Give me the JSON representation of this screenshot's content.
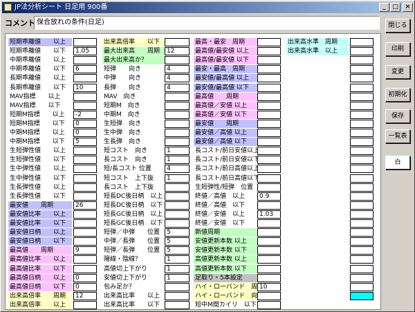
{
  "window": {
    "title": "JP法分析シート 日足用 900番",
    "minimize": "_",
    "maximize": "□",
    "close": "×"
  },
  "comment": {
    "label": "コメント",
    "value": "保合放れの条件(日足)"
  },
  "buttons": [
    {
      "name": "close-button",
      "label": "閉じる"
    },
    {
      "name": "print-button",
      "label": "印刷"
    },
    {
      "name": "change-button",
      "label": "変更"
    },
    {
      "name": "initialize-button",
      "label": "初期化"
    },
    {
      "name": "save-button",
      "label": "保存"
    },
    {
      "name": "list-button",
      "label": "一覧表"
    },
    {
      "name": "white-button",
      "label": "白"
    }
  ],
  "colors": {
    "yellow": "#ffffc0",
    "green": "#c0ffc0",
    "blue": "#c0c0ff",
    "pink": "#ffc0ff",
    "cyan": "#c0ffff",
    "gray": "#c0c0c0",
    "white": "#ffffff"
  },
  "columns": [
    {
      "rows": [
        {
          "label": "短期乖離値　　以上",
          "color": "blue",
          "value": ""
        },
        {
          "label": "短期乖離値　　以下",
          "color": "white",
          "value": "1.05"
        },
        {
          "label": "中期乖離値　　以上",
          "color": "white",
          "value": ""
        },
        {
          "label": "中期乖離値　　以下",
          "color": "white",
          "value": "6"
        },
        {
          "label": "長期乖離値　　以上",
          "color": "white",
          "value": ""
        },
        {
          "label": "長期乖離値　　以下",
          "color": "white",
          "value": "10"
        },
        {
          "label": "MAV指標　　以上",
          "color": "white",
          "value": ""
        },
        {
          "label": "MAV指標　　以下",
          "color": "white",
          "value": ""
        },
        {
          "label": "短期M指標　　以上",
          "color": "white",
          "value": "-2"
        },
        {
          "label": "短期M指標　　以下",
          "color": "white",
          "value": "0"
        },
        {
          "label": "中期M指標　　以上",
          "color": "white",
          "value": "0"
        },
        {
          "label": "中期M指標　　以下",
          "color": "white",
          "value": "5"
        },
        {
          "label": "生短弾性値　　以上",
          "color": "white",
          "value": ""
        },
        {
          "label": "生短弾性値　　以下",
          "color": "white",
          "value": ""
        },
        {
          "label": "生中弾性値　　以上",
          "color": "white",
          "value": ""
        },
        {
          "label": "生中弾性値　　以下",
          "color": "white",
          "value": ""
        },
        {
          "label": "生長弾性値　　以上",
          "color": "white",
          "value": ""
        },
        {
          "label": "生長弾性値　　以下",
          "color": "white",
          "value": ""
        },
        {
          "label": "最安値　　周期",
          "color": "blue",
          "value": "26"
        },
        {
          "label": "最安値比率　　以上",
          "color": "blue",
          "value": ""
        },
        {
          "label": "最安値比率　　以下",
          "color": "blue",
          "value": ""
        },
        {
          "label": "最安値日柄　　以上",
          "color": "blue",
          "value": ""
        },
        {
          "label": "最安値日柄　　以下",
          "color": "blue",
          "value": ""
        },
        {
          "label": "最高値　　周期",
          "color": "pink",
          "value": "9"
        },
        {
          "label": "最高値比率　　以上",
          "color": "pink",
          "value": ""
        },
        {
          "label": "最高値比率　　以下",
          "color": "pink",
          "value": ""
        },
        {
          "label": "最高値日柄　　以上",
          "color": "pink",
          "value": "0"
        },
        {
          "label": "最高値日柄　　以下",
          "color": "pink",
          "value": "0"
        },
        {
          "label": "出来高倍率　　周期",
          "color": "yellow",
          "value": "12"
        },
        {
          "label": "出来高倍率　　以上",
          "color": "yellow",
          "value": ""
        }
      ]
    },
    {
      "rows": [
        {
          "label": "出来高倍率　　以下",
          "color": "yellow",
          "value": ""
        },
        {
          "label": "最大出来高　　周期",
          "color": "green",
          "value": "12"
        },
        {
          "label": "最大出来高か？",
          "color": "green",
          "value": ""
        },
        {
          "label": "短弾　　向き",
          "color": "white",
          "value": "4"
        },
        {
          "label": "中弾　　向き",
          "color": "white",
          "value": "4"
        },
        {
          "label": "長弾　　向き",
          "color": "white",
          "value": "4"
        },
        {
          "label": "MAV　向き",
          "color": "white",
          "value": ""
        },
        {
          "label": "短期M　向き",
          "color": "white",
          "value": ""
        },
        {
          "label": "中期M　向き",
          "color": "white",
          "value": ""
        },
        {
          "label": "生短弾　向き",
          "color": "white",
          "value": ""
        },
        {
          "label": "生中弾　向き",
          "color": "white",
          "value": ""
        },
        {
          "label": "生長弾　向き",
          "color": "white",
          "value": ""
        },
        {
          "label": "短コスト　向き",
          "color": "white",
          "value": "1"
        },
        {
          "label": "長コスト　向き",
          "color": "white",
          "value": "1"
        },
        {
          "label": "短/長コスト 位置",
          "color": "white",
          "value": "4"
        },
        {
          "label": "短コスト　上下抜",
          "color": "white",
          "value": "1"
        },
        {
          "label": "長コスト　上下抜",
          "color": "white",
          "value": ""
        },
        {
          "label": "短長DC後日柄　以上",
          "color": "white",
          "value": ""
        },
        {
          "label": "短長DC後日柄　以下",
          "color": "white",
          "value": ""
        },
        {
          "label": "短長GC後日柄　以上",
          "color": "white",
          "value": ""
        },
        {
          "label": "短長GC後日柄　以下",
          "color": "white",
          "value": ""
        },
        {
          "label": "短弾／中弾　　位置",
          "color": "white",
          "value": "5"
        },
        {
          "label": "中弾／長弾　　位置",
          "color": "white",
          "value": "5"
        },
        {
          "label": "短弾／長弾　　位置",
          "color": "white",
          "value": "5"
        },
        {
          "label": "陽線・陰線？",
          "color": "white",
          "value": "1"
        },
        {
          "label": "高値切上下がり",
          "color": "white",
          "value": "1"
        },
        {
          "label": "安値切上下がり",
          "color": "white",
          "value": "1"
        },
        {
          "label": "包み足か？",
          "color": "white",
          "value": ""
        },
        {
          "label": "出来高比率　　以上",
          "color": "white",
          "value": ""
        },
        {
          "label": "出来高比率　　以下",
          "color": "white",
          "value": ""
        }
      ]
    },
    {
      "rows": [
        {
          "label": "最高・最安　周期",
          "color": "pink",
          "value": ""
        },
        {
          "label": "最高値/最安値 以上",
          "color": "pink",
          "value": ""
        },
        {
          "label": "最高値/最安値 以下",
          "color": "pink",
          "value": ""
        },
        {
          "label": "最安・最高　周期",
          "color": "blue",
          "value": ""
        },
        {
          "label": "最安値/最高値 以上",
          "color": "blue",
          "value": ""
        },
        {
          "label": "最安値/最高値 以下",
          "color": "blue",
          "value": ""
        },
        {
          "label": "最高値　　周期",
          "color": "pink",
          "value": ""
        },
        {
          "label": "最高値／安値 以上",
          "color": "pink",
          "value": ""
        },
        {
          "label": "最高値／安値 以下",
          "color": "pink",
          "value": ""
        },
        {
          "label": "最安値　　周期",
          "color": "blue",
          "value": ""
        },
        {
          "label": "最安値／高値 以上",
          "color": "blue",
          "value": ""
        },
        {
          "label": "最安値／高値 以下",
          "color": "blue",
          "value": ""
        },
        {
          "label": "長コスト/前日安値以上",
          "color": "white",
          "value": ""
        },
        {
          "label": "長コスト/前日安値以下",
          "color": "white",
          "value": ""
        },
        {
          "label": "長コスト/前日高値以上",
          "color": "white",
          "value": ""
        },
        {
          "label": "長コスト/前日高値以下",
          "color": "white",
          "value": ""
        },
        {
          "label": "生短弾性/短弾　位置",
          "color": "white",
          "value": ""
        },
        {
          "label": "終値／高値　以上",
          "color": "white",
          "value": "0.9"
        },
        {
          "label": "終値／高値　以下",
          "color": "white",
          "value": ""
        },
        {
          "label": "終値／安値　以上",
          "color": "white",
          "value": "1.03"
        },
        {
          "label": "終値／安値　以下",
          "color": "white",
          "value": ""
        },
        {
          "label": "新値周期",
          "color": "green",
          "value": ""
        },
        {
          "label": "安値更新本数 以上",
          "color": "green",
          "value": ""
        },
        {
          "label": "安値更新本数 以下",
          "color": "green",
          "value": ""
        },
        {
          "label": "高値更新本数 以上",
          "color": "green",
          "value": ""
        },
        {
          "label": "高値更新本数 以下",
          "color": "green",
          "value": ""
        },
        {
          "label": "足取り・5本設定",
          "color": "gray",
          "value": ""
        },
        {
          "label": "ハイ・ローバンド　周期",
          "color": "yellow",
          "value": "10"
        },
        {
          "label": "ハイ・ローバンド　向き",
          "color": "yellow",
          "value": ""
        },
        {
          "label": "短中M間カイリ　以下",
          "color": "white",
          "value": ""
        }
      ]
    },
    {
      "rows": [
        {
          "label": "出来高水準　周期",
          "color": "cyan",
          "value": ""
        },
        {
          "label": "出来高水準　以上",
          "color": "cyan",
          "value": ""
        }
      ],
      "extra_inputs": 27,
      "last_input_cyan": true
    }
  ]
}
